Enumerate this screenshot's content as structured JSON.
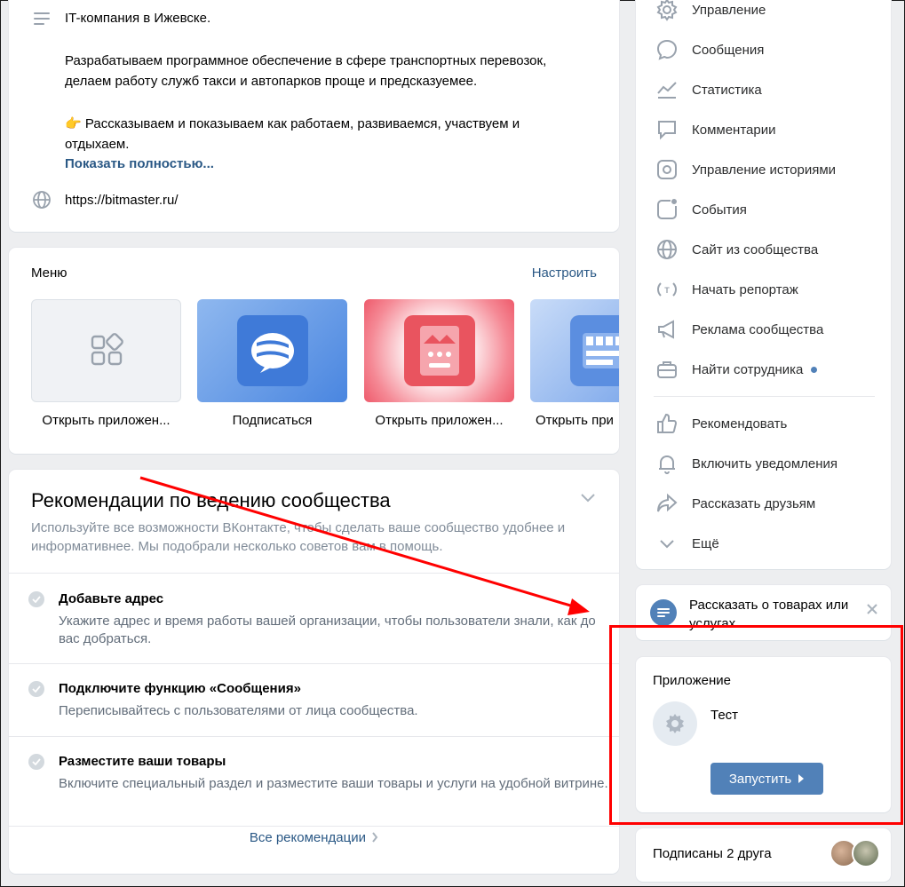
{
  "info": {
    "line1": "IT-компания в Ижевске.",
    "line2": "Разрабатываем программное обеспечение в сфере транспортных перевозок,",
    "line3": "делаем работу служб такси и автопарков проще и предсказуемее.",
    "emoji": "👉",
    "line4": "Рассказываем и показываем как работаем, развиваемся, участвуем и",
    "line5": "отдыхаем.",
    "more_label": "Показать полностью...",
    "site": "https://bitmaster.ru/"
  },
  "menu": {
    "title": "Меню",
    "setup_label": "Настроить",
    "tiles": [
      {
        "label": "Открыть приложен..."
      },
      {
        "label": "Подписаться"
      },
      {
        "label": "Открыть приложен..."
      },
      {
        "label": "Открыть при"
      }
    ]
  },
  "recommendations": {
    "title": "Рекомендации по ведению сообщества",
    "subtitle": "Используйте все возможности ВКонтакте, чтобы сделать ваше сообщество удобнее и информативнее. Мы подобрали несколько советов вам в помощь.",
    "items": [
      {
        "title": "Добавьте адрес",
        "desc": "Укажите адрес и время работы вашей организации, чтобы пользователи знали, как до вас добраться."
      },
      {
        "title": "Подключите функцию «Сообщения»",
        "desc": "Переписывайтесь с пользователями от лица сообщества."
      },
      {
        "title": "Разместите ваши товары",
        "desc": "Включите специальный раздел и разместите ваши товары и услуги на удобной витрине."
      }
    ],
    "all_label": "Все рекомендации"
  },
  "sidebar": {
    "items": [
      {
        "label": "Управление",
        "icon": "gear-icon"
      },
      {
        "label": "Сообщения",
        "icon": "message-icon"
      },
      {
        "label": "Статистика",
        "icon": "stats-icon"
      },
      {
        "label": "Комментарии",
        "icon": "comment-icon"
      },
      {
        "label": "Управление историями",
        "icon": "stories-icon"
      },
      {
        "label": "События",
        "icon": "events-icon"
      },
      {
        "label": "Сайт из сообщества",
        "icon": "globe-icon"
      },
      {
        "label": "Начать репортаж",
        "icon": "live-icon"
      },
      {
        "label": "Реклама сообщества",
        "icon": "megaphone-icon"
      },
      {
        "label": "Найти сотрудника",
        "icon": "briefcase-icon"
      },
      {
        "label": "Рекомендовать",
        "icon": "like-icon"
      },
      {
        "label": "Включить уведомления",
        "icon": "bell-icon"
      },
      {
        "label": "Рассказать друзьям",
        "icon": "share-icon"
      },
      {
        "label": "Ещё",
        "icon": "chevron-down-icon"
      }
    ]
  },
  "goods": {
    "text": "Рассказать о товарах или услугах"
  },
  "app": {
    "title": "Приложение",
    "name": "Тест",
    "button_label": "Запустить"
  },
  "friends": {
    "text": "Подписаны 2 друга"
  },
  "colors": {
    "accent": "#5181b8",
    "link": "#2a5885",
    "annotation": "#ff0000"
  }
}
